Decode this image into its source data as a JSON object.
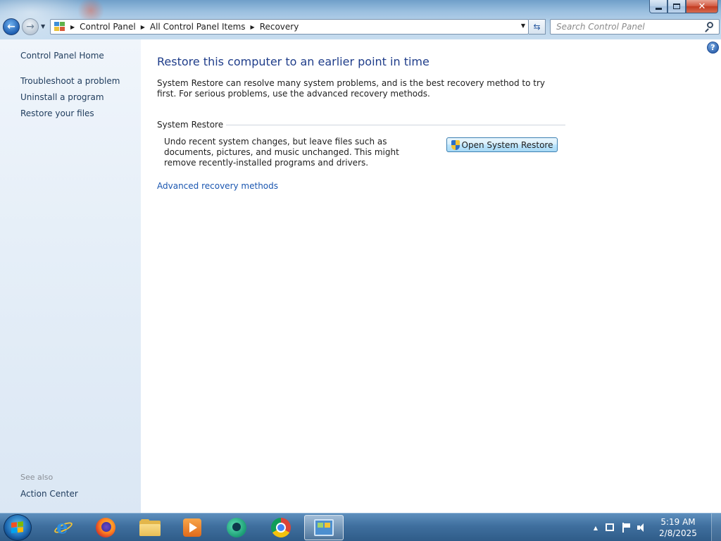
{
  "window": {
    "controls": {
      "minimize": "minimize",
      "maximize": "restore",
      "close": "close"
    }
  },
  "address": {
    "breadcrumbs": [
      "Control Panel",
      "All Control Panel Items",
      "Recovery"
    ]
  },
  "search": {
    "placeholder": "Search Control Panel"
  },
  "sidebar": {
    "home": "Control Panel Home",
    "items": [
      "Troubleshoot a problem",
      "Uninstall a program",
      "Restore your files"
    ],
    "see_also_title": "See also",
    "see_also_items": [
      "Action Center"
    ]
  },
  "main": {
    "title": "Restore this computer to an earlier point in time",
    "intro": "System Restore can resolve many system problems, and is the best recovery method to try first. For serious problems, use the advanced recovery methods.",
    "section_title": "System Restore",
    "section_description": "Undo recent system changes, but leave files such as documents, pictures, and music unchanged. This might remove recently-installed programs and drivers.",
    "open_button": "Open System Restore",
    "advanced_link": "Advanced recovery methods"
  },
  "taskbar": {
    "apps": [
      "internet-explorer-icon",
      "firefox-icon",
      "file-explorer-icon",
      "media-player-icon",
      "chat-app-icon",
      "chrome-icon",
      "control-panel-icon"
    ],
    "active_app": "control-panel-icon",
    "clock_time": "5:19 AM",
    "clock_date": "2/8/2025"
  },
  "colors": {
    "title_blue": "#1f3d8a",
    "link_blue": "#1a56b0",
    "sidebar_bg": "#e6eff8",
    "taskbar_bg": "#3f6f9e"
  }
}
